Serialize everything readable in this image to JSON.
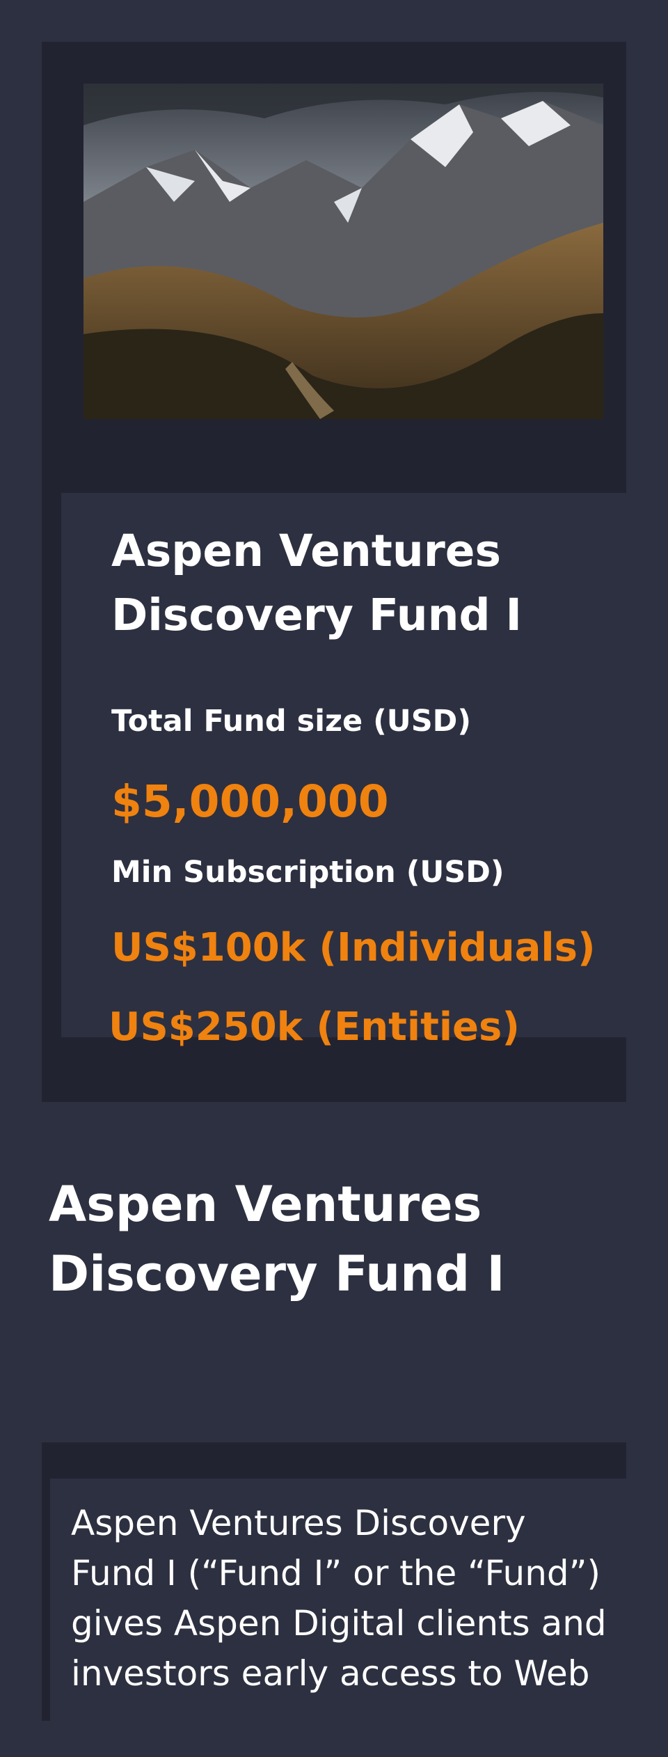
{
  "fund_card": {
    "image_alt": "Mountain range landscape",
    "title": "Aspen Ventures Discovery Fund I",
    "fund_size_label": "Total Fund size (USD)",
    "fund_size_value": "$5,000,000",
    "min_subscription_label": "Min Subscription (USD)",
    "min_individuals": "US$100k (Individuals)",
    "min_entities": "US$250k (Entities)"
  },
  "section": {
    "title": "Aspen Ventures Discovery Fund I"
  },
  "description": {
    "text": "Aspen Ventures Discovery Fund I (“Fund I” or the “Fund”) gives Aspen Digital clients and investors early access to Web"
  },
  "colors": {
    "background": "#2d3040",
    "card": "#222331",
    "accent": "#f0820f"
  }
}
